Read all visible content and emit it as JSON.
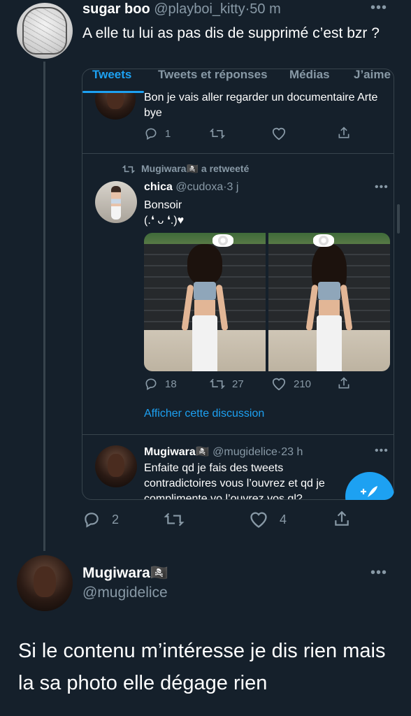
{
  "top_tweet": {
    "display_name": "sugar boo",
    "handle": "@playboi_kitty",
    "time": "50 m",
    "separator": "·",
    "text": "A elle tu lui as pas dis de supprimé c’est bzr ?",
    "actions": {
      "replies": "2",
      "likes": "4"
    }
  },
  "embedded": {
    "tabs": [
      "Tweets",
      "Tweets et réponses",
      "Médias",
      "J’aime"
    ],
    "partial_tweet_text": "Bon je vais aller regarder un documentaire Arte bye",
    "partial_tweet_actions": {
      "replies": "1"
    },
    "retweet_label": "Mugiwara🏴‍☠️ a retweeté",
    "retweet": {
      "display_name": "chica",
      "handle": "@cudoxa",
      "time": "3 j",
      "separator": "·",
      "line1": "Bonsoir",
      "line2": "(.❛ ᴗ ❛.)♥",
      "actions": {
        "replies": "18",
        "retweets": "27",
        "likes": "210"
      },
      "show_thread": "Afficher cette discussion"
    },
    "bottom_tweet": {
      "display_name": "Mugiwara🏴‍☠️",
      "handle": "@mugidelice",
      "time": "23 h",
      "separator": "·",
      "text": "Enfaite qd je fais des tweets contradictoires vous l’ouvrez et qd je complimente vo l’ouvrez vos gl?"
    }
  },
  "main_tweet": {
    "display_name": "Mugiwara🏴‍☠️",
    "handle": "@mugidelice",
    "text": "Si le contenu m’intéresse je dis rien mais la sa photo elle dégage rien"
  },
  "colors": {
    "background": "#15202b",
    "muted": "#8899a6",
    "accent": "#1da1f2",
    "border": "#38444d"
  },
  "icons": [
    "reply-icon",
    "retweet-icon",
    "like-icon",
    "share-icon",
    "more-icon",
    "compose-icon"
  ]
}
